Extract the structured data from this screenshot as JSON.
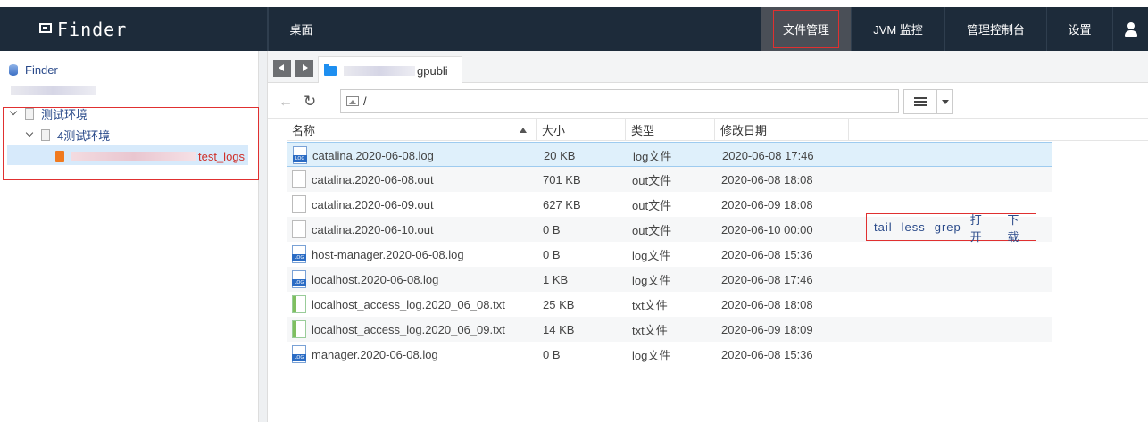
{
  "app": {
    "brand": "Finder",
    "nav": [
      {
        "label": "桌面"
      },
      {
        "label": "文件管理"
      },
      {
        "label": "JVM 监控"
      },
      {
        "label": "管理控制台"
      },
      {
        "label": "设置"
      }
    ],
    "user_icon": "user-icon"
  },
  "tree": {
    "root": "Finder",
    "env_label": "测试环境",
    "sub_env_label": "4测试环境",
    "leaf_label": "test_logs"
  },
  "tab": {
    "title": "gpubli"
  },
  "address": {
    "path": "/"
  },
  "table": {
    "columns": [
      "名称",
      "大小",
      "类型",
      "修改日期"
    ],
    "rows": [
      {
        "name": "catalina.2020-06-08.log",
        "size": "20 KB",
        "type": "log文件",
        "date": "2020-06-08 17:46",
        "icon": "log"
      },
      {
        "name": "catalina.2020-06-08.out",
        "size": "701 KB",
        "type": "out文件",
        "date": "2020-06-08 18:08",
        "icon": "out"
      },
      {
        "name": "catalina.2020-06-09.out",
        "size": "627 KB",
        "type": "out文件",
        "date": "2020-06-09 18:08",
        "icon": "out"
      },
      {
        "name": "catalina.2020-06-10.out",
        "size": "0 B",
        "type": "out文件",
        "date": "2020-06-10 00:00",
        "icon": "out"
      },
      {
        "name": "host-manager.2020-06-08.log",
        "size": "0 B",
        "type": "log文件",
        "date": "2020-06-08 15:36",
        "icon": "log"
      },
      {
        "name": "localhost.2020-06-08.log",
        "size": "1 KB",
        "type": "log文件",
        "date": "2020-06-08 17:46",
        "icon": "log"
      },
      {
        "name": "localhost_access_log.2020_06_08.txt",
        "size": "25 KB",
        "type": "txt文件",
        "date": "2020-06-08 18:08",
        "icon": "txt"
      },
      {
        "name": "localhost_access_log.2020_06_09.txt",
        "size": "14 KB",
        "type": "txt文件",
        "date": "2020-06-09 18:09",
        "icon": "txt"
      },
      {
        "name": "manager.2020-06-08.log",
        "size": "0 B",
        "type": "log文件",
        "date": "2020-06-08 15:36",
        "icon": "log"
      }
    ],
    "row_actions": [
      "tail",
      "less",
      "grep",
      "打 开",
      "下 载"
    ]
  }
}
